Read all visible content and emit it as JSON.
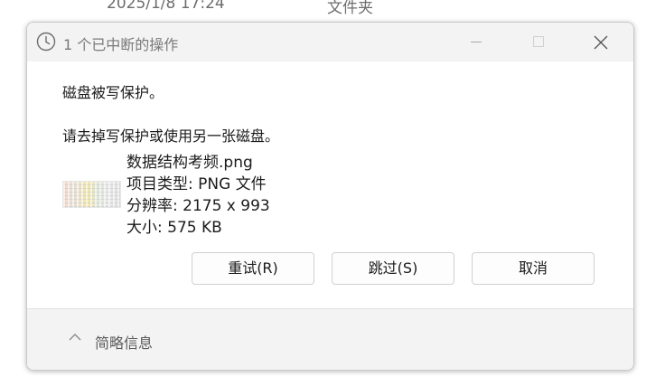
{
  "background": {
    "date_text": "2025/1/8 17:24",
    "type_text": "文件夹"
  },
  "dialog": {
    "title": "1 个已中断的操作",
    "message_title": "磁盘被写保护。",
    "message_detail": "请去掉写保护或使用另一张磁盘。",
    "file": {
      "name": "数据结构考频.png",
      "type_line": "项目类型: PNG 文件",
      "resolution_line": "分辨率: 2175 x 993",
      "size_line": "大小: 575 KB"
    },
    "buttons": {
      "retry": "重试(R)",
      "skip": "跳过(S)",
      "cancel": "取消"
    },
    "footer": {
      "summary_label": "简略信息"
    }
  },
  "colors": {
    "titlebar_bg": "#f3f3f3",
    "text": "#1b1b1b",
    "muted_text": "#7a7a7a"
  },
  "icons": [
    "clock-icon",
    "minimize-icon",
    "maximize-icon",
    "close-icon",
    "chevron-up-icon"
  ]
}
